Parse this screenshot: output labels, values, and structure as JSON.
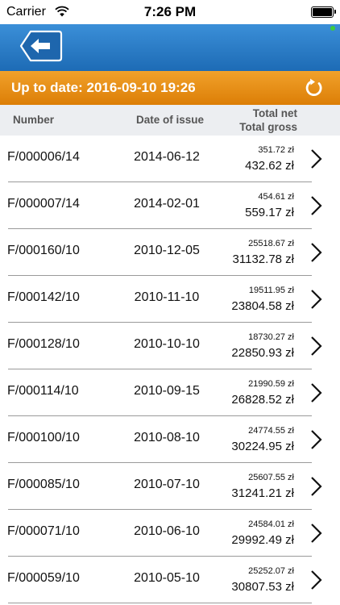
{
  "status_bar": {
    "carrier": "Carrier",
    "time": "7:26 PM"
  },
  "nav": {
    "back_icon": "back-arrow-icon"
  },
  "update": {
    "text": "Up to date: 2016-09-10 19:26",
    "refresh_icon": "refresh-icon"
  },
  "colors": {
    "nav_blue": "#2a7cc8",
    "update_orange": "#e88e16",
    "header_gray": "#eceef1"
  },
  "table": {
    "headers": {
      "number": "Number",
      "date": "Date of issue",
      "total_net": "Total net",
      "total_gross": "Total gross"
    },
    "rows": [
      {
        "number": "F/000006/14",
        "date": "2014-06-12",
        "net": "351.72 zł",
        "gross": "432.62 zł"
      },
      {
        "number": "F/000007/14",
        "date": "2014-02-01",
        "net": "454.61 zł",
        "gross": "559.17 zł"
      },
      {
        "number": "F/000160/10",
        "date": "2010-12-05",
        "net": "25518.67 zł",
        "gross": "31132.78 zł"
      },
      {
        "number": "F/000142/10",
        "date": "2010-11-10",
        "net": "19511.95 zł",
        "gross": "23804.58 zł"
      },
      {
        "number": "F/000128/10",
        "date": "2010-10-10",
        "net": "18730.27 zł",
        "gross": "22850.93 zł"
      },
      {
        "number": "F/000114/10",
        "date": "2010-09-15",
        "net": "21990.59 zł",
        "gross": "26828.52 zł"
      },
      {
        "number": "F/000100/10",
        "date": "2010-08-10",
        "net": "24774.55 zł",
        "gross": "30224.95 zł"
      },
      {
        "number": "F/000085/10",
        "date": "2010-07-10",
        "net": "25607.55 zł",
        "gross": "31241.21 zł"
      },
      {
        "number": "F/000071/10",
        "date": "2010-06-10",
        "net": "24584.01 zł",
        "gross": "29992.49 zł"
      },
      {
        "number": "F/000059/10",
        "date": "2010-05-10",
        "net": "25252.07 zł",
        "gross": "30807.53 zł"
      }
    ]
  }
}
